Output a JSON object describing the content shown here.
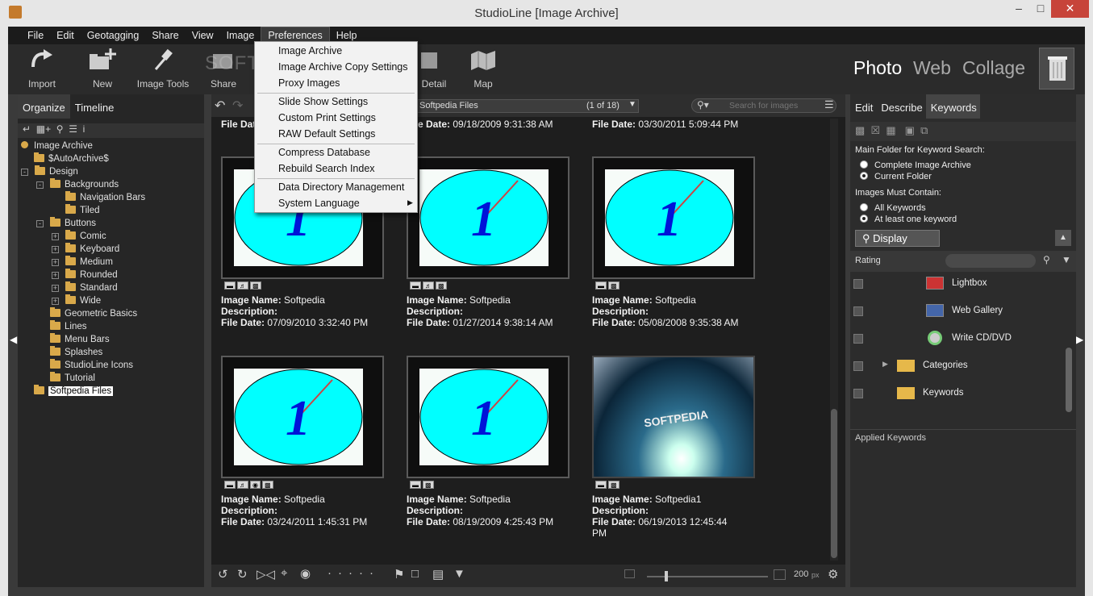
{
  "window": {
    "title": "StudioLine [Image Archive]"
  },
  "menu": [
    "File",
    "Edit",
    "Geotagging",
    "Share",
    "View",
    "Image",
    "Preferences",
    "Help"
  ],
  "menu_active": "Preferences",
  "toolbar": {
    "import": "Import",
    "new": "New",
    "image_tools": "Image Tools",
    "share": "Share",
    "detail": "Detail",
    "map": "Map"
  },
  "modes": [
    "Photo",
    "Web",
    "Collage"
  ],
  "left": {
    "tabs": [
      "Organize",
      "Timeline"
    ],
    "tree": [
      {
        "label": "Image Archive"
      },
      {
        "label": "$AutoArchive$"
      },
      {
        "label": "Design"
      },
      {
        "label": "Backgrounds"
      },
      {
        "label": "Navigation Bars"
      },
      {
        "label": "Tiled"
      },
      {
        "label": "Buttons"
      },
      {
        "label": "Comic"
      },
      {
        "label": "Keyboard"
      },
      {
        "label": "Medium"
      },
      {
        "label": "Rounded"
      },
      {
        "label": "Standard"
      },
      {
        "label": "Wide"
      },
      {
        "label": "Geometric Basics"
      },
      {
        "label": "Lines"
      },
      {
        "label": "Menu Bars"
      },
      {
        "label": "Splashes"
      },
      {
        "label": "StudioLine Icons"
      },
      {
        "label": "Tutorial"
      },
      {
        "label": "Softpedia Files"
      }
    ]
  },
  "center": {
    "folder": "Softpedia Files",
    "count": "(1 of 18)",
    "search_placeholder": "Search for images",
    "labels": {
      "name": "Image Name:",
      "desc": "Description:",
      "date": "File Date:"
    },
    "top_dates": [
      "09/18/2009 9:31:38 AM",
      "03/30/2011 5:09:44 PM"
    ],
    "top_partial": "File Dat",
    "items": [
      {
        "name": "Softpedia",
        "date": "07/09/2010 3:32:40 PM"
      },
      {
        "name": "Softpedia",
        "date": "01/27/2014 9:38:14 AM"
      },
      {
        "name": "Softpedia",
        "date": "05/08/2008 9:35:38 AM"
      },
      {
        "name": "Softpedia",
        "date": "03/24/2011 1:45:31 PM"
      },
      {
        "name": "Softpedia",
        "date": "08/19/2009 4:25:43 PM"
      },
      {
        "name": "Softpedia1",
        "date": "06/19/2013 12:45:44 PM"
      }
    ],
    "zoom": "200",
    "zoom_unit": "px",
    "photo_text": "SOFTPEDIA"
  },
  "dropdown": [
    "Image Archive",
    "Image Archive Copy Settings",
    "Proxy Images",
    "Slide Show Settings",
    "Custom Print Settings",
    "RAW Default Settings",
    "Compress Database",
    "Rebuild Search Index",
    "Data Directory Management",
    "System Language"
  ],
  "right": {
    "tabs": [
      "Edit",
      "Describe",
      "Keywords"
    ],
    "main_folder_label": "Main Folder for Keyword Search:",
    "folder_opts": [
      "Complete Image Archive",
      "Current Folder"
    ],
    "must_contain_label": "Images Must Contain:",
    "contain_opts": [
      "All Keywords",
      "At least one keyword"
    ],
    "display": "Display",
    "rating": "Rating",
    "keywords": [
      "Lightbox",
      "Web Gallery",
      "Write CD/DVD",
      "Categories",
      "Keywords"
    ],
    "applied": "Applied Keywords"
  },
  "watermark": "SOFTPE"
}
